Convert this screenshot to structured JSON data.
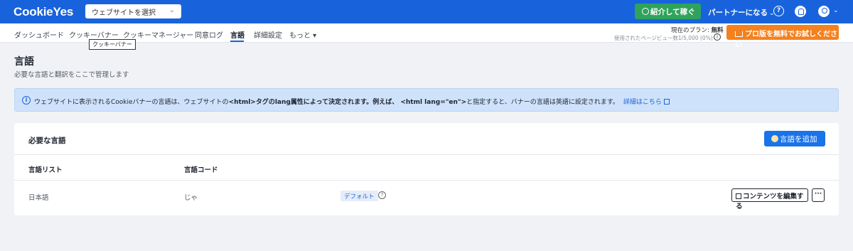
{
  "header": {
    "logo": "CookieYes",
    "site_select": {
      "value": "ウェブサイトを選択"
    },
    "referral_button": "紹介して稼ぐ",
    "partner_menu": "パートナーになる",
    "help_icon_glyph": "?"
  },
  "nav": {
    "items": [
      {
        "label": "ダッシュボード"
      },
      {
        "label": "クッキーバナー"
      },
      {
        "label": "クッキーマネージャー"
      },
      {
        "label": "同意ログ"
      },
      {
        "label": "言語",
        "active": true
      },
      {
        "label": "詳細設定"
      },
      {
        "label": "もっと ▾"
      }
    ],
    "tooltip": "クッキーバナー"
  },
  "plan": {
    "label": "現在のプラン:",
    "name": "無料",
    "pageviews": "使用されたページビュー数1/5,000 (0%)",
    "info_glyph": "i",
    "trial_button": "プロ版を無料でお試しください"
  },
  "page": {
    "title": "言語",
    "subtitle": "必要な言語と翻訳をここで管理します"
  },
  "banner": {
    "info_glyph": "i",
    "text_1": "ウェブサイトに表示されるCookieバナーの言語は、ウェブサイトの",
    "text_2": "<html>タグのlang属性によって決定されます。例えば、 <html lang=\"en\">",
    "text_3": "と指定すると、バナーの言語は英語に設定されます。",
    "link": "詳細はこちら"
  },
  "card": {
    "title": "必要な言語",
    "add_button": "言語を追加",
    "columns": [
      "言語リスト",
      "言語コード"
    ],
    "rows": [
      {
        "language": "日本語",
        "code": "じゃ",
        "badge": "デフォルト",
        "badge_help": "?",
        "edit_button": "コンテンツを編集する",
        "more": "···"
      }
    ]
  },
  "colors": {
    "brand_blue": "#1863dc",
    "referral_green": "#2fa35b",
    "trial_orange": "#f4811f",
    "banner_bg": "#cfe2fb"
  }
}
